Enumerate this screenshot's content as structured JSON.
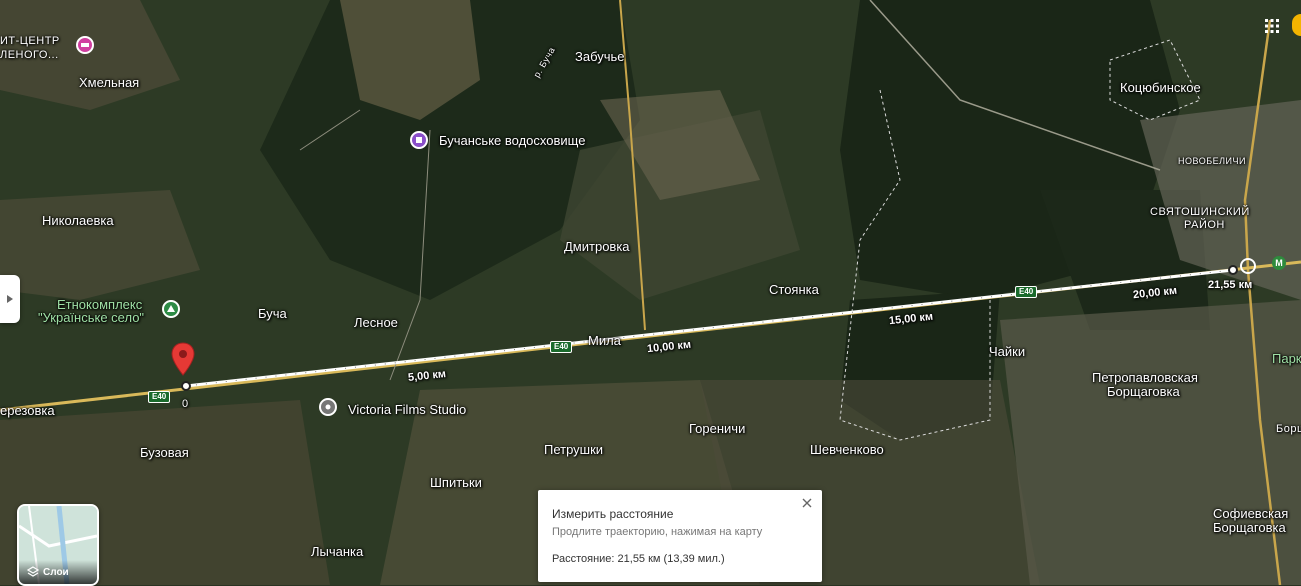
{
  "map": {
    "places": [
      {
        "key": "khmelnaya",
        "text": "Хмельная"
      },
      {
        "key": "zabuchye",
        "text": "Забучье"
      },
      {
        "key": "reservoir",
        "text": "Бучанське водосховище"
      },
      {
        "key": "kotsyubinskoe",
        "text": "Коцюбинское"
      },
      {
        "key": "novobelichi",
        "text": "НОВОБЕЛИЧИ"
      },
      {
        "key": "sviatoshynskyi_1",
        "text": "СВЯТОШИНСКИЙ"
      },
      {
        "key": "sviatoshynskyi_2",
        "text": "РАЙОН"
      },
      {
        "key": "nikolaevka",
        "text": "Николаевка"
      },
      {
        "key": "dmitrovka",
        "text": "Дмитровка"
      },
      {
        "key": "stoyanka",
        "text": "Стоянка"
      },
      {
        "key": "ethno_1",
        "text": "Етнокомплекс"
      },
      {
        "key": "ethno_2",
        "text": "\"Українське село\""
      },
      {
        "key": "bucha",
        "text": "Буча"
      },
      {
        "key": "lesnoe",
        "text": "Лесное"
      },
      {
        "key": "mila",
        "text": "Мила"
      },
      {
        "key": "chaiki",
        "text": "Чайки"
      },
      {
        "key": "petropavl_1",
        "text": "Петропавловская"
      },
      {
        "key": "petropavl_2",
        "text": "Борщаговка"
      },
      {
        "key": "berezovka",
        "text": "ерезовка"
      },
      {
        "key": "victoria",
        "text": "Victoria Films Studio"
      },
      {
        "key": "buzovaya",
        "text": "Бузовая"
      },
      {
        "key": "petrushki",
        "text": "Петрушки"
      },
      {
        "key": "gorenichi",
        "text": "Гореничи"
      },
      {
        "key": "shevchenkovo",
        "text": "Шевченково"
      },
      {
        "key": "shpitki",
        "text": "Шпитьки"
      },
      {
        "key": "sofievskaya_1",
        "text": "Софиевская"
      },
      {
        "key": "sofievskaya_2",
        "text": "Борщаговка"
      },
      {
        "key": "lychanka",
        "text": "Лычанка"
      },
      {
        "key": "top_left_1",
        "text": "ИТ-ЦЕНТР"
      },
      {
        "key": "top_left_2",
        "text": "ЛЕНОГО..."
      },
      {
        "key": "river_bucha",
        "text": "р. Буча"
      },
      {
        "key": "park",
        "text": "Парк"
      },
      {
        "key": "borsch_edge",
        "text": "Борщ"
      }
    ],
    "road_shields": [
      "E40",
      "E40",
      "E40"
    ],
    "distance_labels": [
      "0",
      "5,00 км",
      "10,00 км",
      "15,00 км",
      "20,00 км",
      "21,55 км"
    ]
  },
  "side_panel_toggle": {
    "icon": "chevron-right-icon"
  },
  "layers_button": {
    "label": "Слои",
    "icon": "layers-icon"
  },
  "apps_button": {
    "icon": "grid-icon"
  },
  "measure_card": {
    "title": "Измерить расстояние",
    "hint": "Продлите траекторию, нажимая на карту",
    "distance": "Расстояние: 21,55 км (13,39 мил.)",
    "close_icon": "close-icon"
  }
}
